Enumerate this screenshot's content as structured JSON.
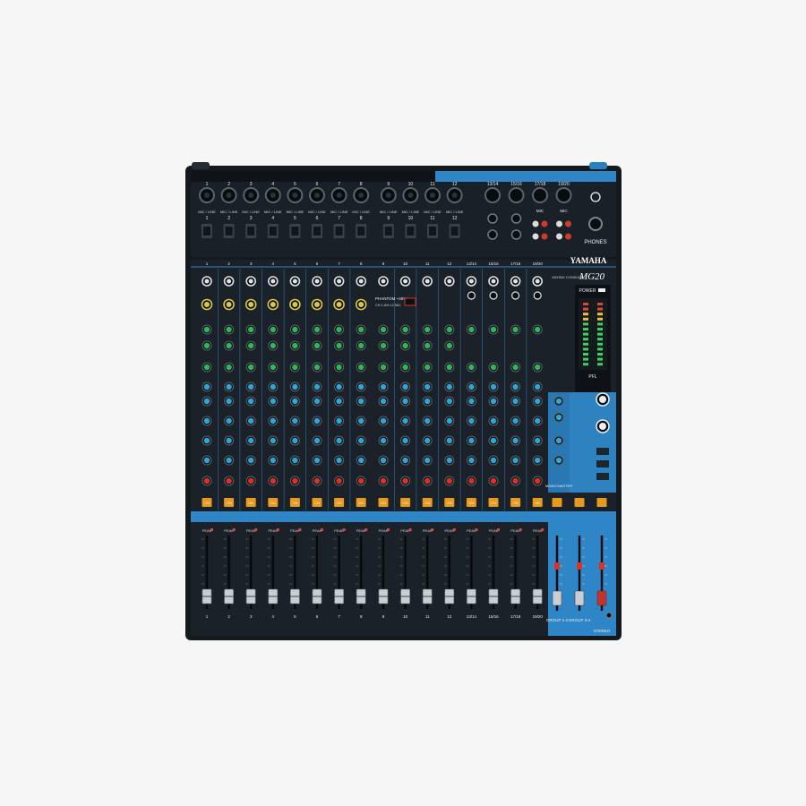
{
  "console": {
    "brand": "YAMAHA",
    "model": "MG20",
    "subtitle": "MIXING CONSOLE",
    "mic_line_label": "MIC / LINE",
    "mic_label": "MIC",
    "phones_label": "PHONES",
    "power_label": "POWER",
    "pfl_label": "PFL",
    "phantom_label": "PHANTOM +48V",
    "phantom_sub": "CH 1-8/9-12 MIC",
    "peak_label": "PEAK",
    "on_label": "ON",
    "group_12_label": "GROUP 1-2",
    "group_34_label": "GROUP 3-4",
    "stereo_label": "STEREO",
    "mono_master_label": "MONO MASTER"
  },
  "top_inputs": {
    "xlr_numbers": [
      "1",
      "2",
      "3",
      "4",
      "5",
      "6",
      "7",
      "8",
      "9",
      "10",
      "11",
      "12"
    ],
    "stereo_numbers": [
      "13/14",
      "15/16",
      "17/18",
      "19/20"
    ],
    "line_numbers": [
      "1",
      "2",
      "3",
      "4",
      "5",
      "6",
      "7",
      "8",
      "9",
      "10",
      "11",
      "12"
    ]
  },
  "channel_numbers": [
    "1",
    "2",
    "3",
    "4",
    "5",
    "6",
    "7",
    "8",
    "9",
    "10",
    "11",
    "12",
    "13/14",
    "15/16",
    "17/18",
    "19/20"
  ],
  "colors": {
    "body": "#161b20",
    "panel": "#1d232a",
    "accent_blue": "#2f86c6",
    "knob_green": "#2fb55a",
    "knob_cyan": "#2aa6d8",
    "knob_red": "#d8332a",
    "knob_yellow": "#d9c64a",
    "on_button": "#e79a22",
    "meter_green": "#40d060"
  }
}
